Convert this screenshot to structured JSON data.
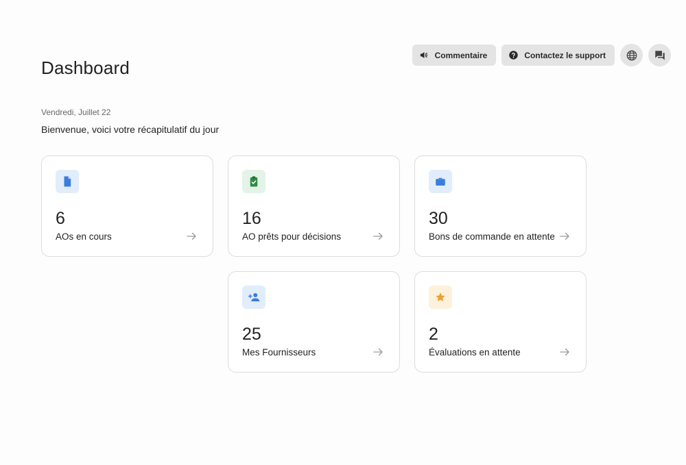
{
  "header": {
    "title": "Dashboard",
    "date": "Vendredi,  Juillet 22",
    "welcome": "Bienvenue, voici votre récapitulatif du jour"
  },
  "topbar": {
    "feedback_label": "Commentaire",
    "support_label": "Contactez le support",
    "language_icon": "globe-icon",
    "chat_icon": "chat-icon"
  },
  "colors": {
    "blue": "#3b7ddd",
    "blue_bg": "#e2edfb",
    "green": "#2e8b46",
    "green_bg": "#e3f3e7",
    "amber": "#eba233",
    "amber_bg": "#fdf1dc"
  },
  "cards": [
    {
      "count": "6",
      "label": "AOs en cours",
      "icon": "document-icon"
    },
    {
      "count": "16",
      "label": "AO prêts pour décisions",
      "icon": "clipboard-check-icon"
    },
    {
      "count": "30",
      "label": "Bons de commande en attente",
      "icon": "briefcase-icon"
    },
    {
      "count": "25",
      "label": "Mes Fournisseurs",
      "icon": "add-person-icon"
    },
    {
      "count": "2",
      "label": "Évaluations en attente",
      "icon": "star-icon"
    }
  ]
}
